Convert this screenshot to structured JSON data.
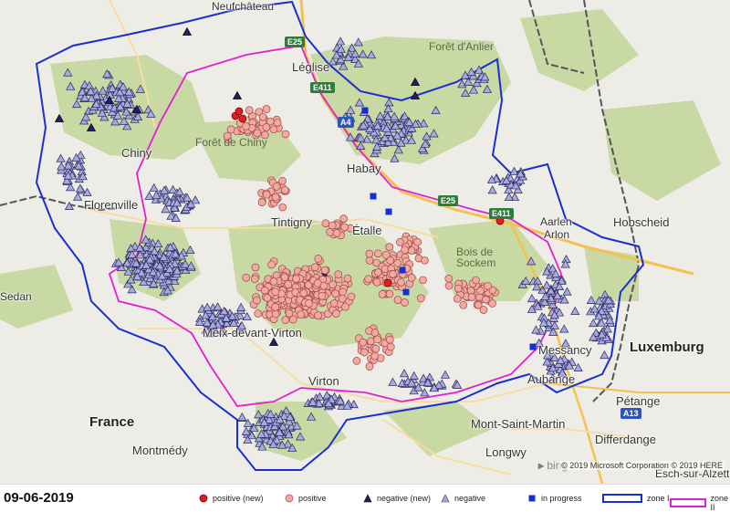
{
  "date": "09-06-2019",
  "map": {
    "places": [
      {
        "name": "Forêt d'Anlier",
        "type": "forest"
      },
      {
        "name": "Léglise",
        "type": "town"
      },
      {
        "name": "Chiny",
        "type": "town"
      },
      {
        "name": "Forêt de Chiny",
        "type": "forest"
      },
      {
        "name": "Habay",
        "type": "town"
      },
      {
        "name": "Florenville",
        "type": "town"
      },
      {
        "name": "Tintigny",
        "type": "town"
      },
      {
        "name": "Étalle",
        "type": "town"
      },
      {
        "name": "Aarlen",
        "type": "town"
      },
      {
        "name": "Arlon",
        "type": "town"
      },
      {
        "name": "Hobscheid",
        "type": "town"
      },
      {
        "name": "Bois de Sockem",
        "type": "forest"
      },
      {
        "name": "Meix-devant-Virton",
        "type": "town"
      },
      {
        "name": "Messancy",
        "type": "town"
      },
      {
        "name": "Luxemburg",
        "type": "country"
      },
      {
        "name": "Aubange",
        "type": "town"
      },
      {
        "name": "Virton",
        "type": "town"
      },
      {
        "name": "Pétange",
        "type": "town"
      },
      {
        "name": "France",
        "type": "country"
      },
      {
        "name": "Mont-Saint-Martin",
        "type": "town"
      },
      {
        "name": "Differdange",
        "type": "town"
      },
      {
        "name": "Montmédy",
        "type": "town"
      },
      {
        "name": "Longwy",
        "type": "town"
      },
      {
        "name": "Esch-sur-Alzette",
        "type": "town"
      },
      {
        "name": "Neufchâteau",
        "type": "town"
      },
      {
        "name": "Sedan",
        "type": "town"
      }
    ],
    "roads": [
      "E25",
      "E411",
      "A4",
      "E25",
      "E411",
      "A13"
    ],
    "copyright": "© 2019 Microsoft Corporation © 2019 HERE",
    "bing": "bing"
  },
  "legend": {
    "positive_new": "positive (new)",
    "positive": "positive",
    "negative_new": "negative (new)",
    "negative": "negative",
    "in_progress": "in progress",
    "zone1": "zone I",
    "zone2": "zone II"
  },
  "colors": {
    "positive_new": "#e02020",
    "positive": "#f4a8a0",
    "negative_new": "#2a1a6a",
    "negative": "#a7a9e0",
    "in_progress": "#1530d0",
    "zone1": "#1a2fd0",
    "zone2": "#e020d0",
    "forest": "#c8d9a4",
    "land": "#eeece6"
  }
}
